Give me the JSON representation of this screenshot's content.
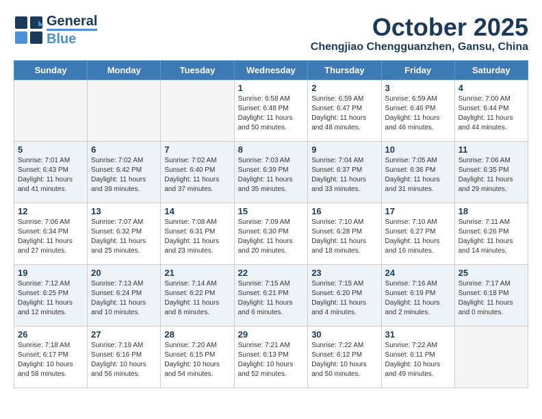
{
  "logo": {
    "line1": "General",
    "line2": "Blue"
  },
  "header": {
    "month": "October 2025",
    "location": "Chengjiao Chengguanzhen, Gansu, China"
  },
  "weekdays": [
    "Sunday",
    "Monday",
    "Tuesday",
    "Wednesday",
    "Thursday",
    "Friday",
    "Saturday"
  ],
  "weeks": [
    [
      {
        "day": "",
        "info": ""
      },
      {
        "day": "",
        "info": ""
      },
      {
        "day": "",
        "info": ""
      },
      {
        "day": "1",
        "info": "Sunrise: 6:58 AM\nSunset: 6:48 PM\nDaylight: 11 hours\nand 50 minutes."
      },
      {
        "day": "2",
        "info": "Sunrise: 6:59 AM\nSunset: 6:47 PM\nDaylight: 11 hours\nand 48 minutes."
      },
      {
        "day": "3",
        "info": "Sunrise: 6:59 AM\nSunset: 6:46 PM\nDaylight: 11 hours\nand 46 minutes."
      },
      {
        "day": "4",
        "info": "Sunrise: 7:00 AM\nSunset: 6:44 PM\nDaylight: 11 hours\nand 44 minutes."
      }
    ],
    [
      {
        "day": "5",
        "info": "Sunrise: 7:01 AM\nSunset: 6:43 PM\nDaylight: 11 hours\nand 41 minutes."
      },
      {
        "day": "6",
        "info": "Sunrise: 7:02 AM\nSunset: 6:42 PM\nDaylight: 11 hours\nand 39 minutes."
      },
      {
        "day": "7",
        "info": "Sunrise: 7:02 AM\nSunset: 6:40 PM\nDaylight: 11 hours\nand 37 minutes."
      },
      {
        "day": "8",
        "info": "Sunrise: 7:03 AM\nSunset: 6:39 PM\nDaylight: 11 hours\nand 35 minutes."
      },
      {
        "day": "9",
        "info": "Sunrise: 7:04 AM\nSunset: 6:37 PM\nDaylight: 11 hours\nand 33 minutes."
      },
      {
        "day": "10",
        "info": "Sunrise: 7:05 AM\nSunset: 6:36 PM\nDaylight: 11 hours\nand 31 minutes."
      },
      {
        "day": "11",
        "info": "Sunrise: 7:06 AM\nSunset: 6:35 PM\nDaylight: 11 hours\nand 29 minutes."
      }
    ],
    [
      {
        "day": "12",
        "info": "Sunrise: 7:06 AM\nSunset: 6:34 PM\nDaylight: 11 hours\nand 27 minutes."
      },
      {
        "day": "13",
        "info": "Sunrise: 7:07 AM\nSunset: 6:32 PM\nDaylight: 11 hours\nand 25 minutes."
      },
      {
        "day": "14",
        "info": "Sunrise: 7:08 AM\nSunset: 6:31 PM\nDaylight: 11 hours\nand 23 minutes."
      },
      {
        "day": "15",
        "info": "Sunrise: 7:09 AM\nSunset: 6:30 PM\nDaylight: 11 hours\nand 20 minutes."
      },
      {
        "day": "16",
        "info": "Sunrise: 7:10 AM\nSunset: 6:28 PM\nDaylight: 11 hours\nand 18 minutes."
      },
      {
        "day": "17",
        "info": "Sunrise: 7:10 AM\nSunset: 6:27 PM\nDaylight: 11 hours\nand 16 minutes."
      },
      {
        "day": "18",
        "info": "Sunrise: 7:11 AM\nSunset: 6:26 PM\nDaylight: 11 hours\nand 14 minutes."
      }
    ],
    [
      {
        "day": "19",
        "info": "Sunrise: 7:12 AM\nSunset: 6:25 PM\nDaylight: 11 hours\nand 12 minutes."
      },
      {
        "day": "20",
        "info": "Sunrise: 7:13 AM\nSunset: 6:24 PM\nDaylight: 11 hours\nand 10 minutes."
      },
      {
        "day": "21",
        "info": "Sunrise: 7:14 AM\nSunset: 6:22 PM\nDaylight: 11 hours\nand 8 minutes."
      },
      {
        "day": "22",
        "info": "Sunrise: 7:15 AM\nSunset: 6:21 PM\nDaylight: 11 hours\nand 6 minutes."
      },
      {
        "day": "23",
        "info": "Sunrise: 7:15 AM\nSunset: 6:20 PM\nDaylight: 11 hours\nand 4 minutes."
      },
      {
        "day": "24",
        "info": "Sunrise: 7:16 AM\nSunset: 6:19 PM\nDaylight: 11 hours\nand 2 minutes."
      },
      {
        "day": "25",
        "info": "Sunrise: 7:17 AM\nSunset: 6:18 PM\nDaylight: 11 hours\nand 0 minutes."
      }
    ],
    [
      {
        "day": "26",
        "info": "Sunrise: 7:18 AM\nSunset: 6:17 PM\nDaylight: 10 hours\nand 58 minutes."
      },
      {
        "day": "27",
        "info": "Sunrise: 7:19 AM\nSunset: 6:16 PM\nDaylight: 10 hours\nand 56 minutes."
      },
      {
        "day": "28",
        "info": "Sunrise: 7:20 AM\nSunset: 6:15 PM\nDaylight: 10 hours\nand 54 minutes."
      },
      {
        "day": "29",
        "info": "Sunrise: 7:21 AM\nSunset: 6:13 PM\nDaylight: 10 hours\nand 52 minutes."
      },
      {
        "day": "30",
        "info": "Sunrise: 7:22 AM\nSunset: 6:12 PM\nDaylight: 10 hours\nand 50 minutes."
      },
      {
        "day": "31",
        "info": "Sunrise: 7:22 AM\nSunset: 6:11 PM\nDaylight: 10 hours\nand 49 minutes."
      },
      {
        "day": "",
        "info": ""
      }
    ]
  ]
}
